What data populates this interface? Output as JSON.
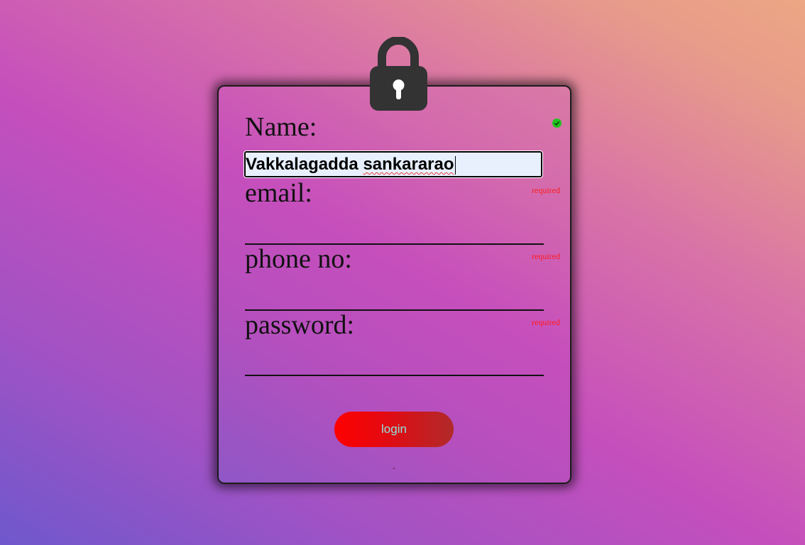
{
  "form": {
    "name_label": "Name:",
    "name_value_part1": "Vakkalagadda ",
    "name_value_part2": "sankararao",
    "email_label": "email:",
    "email_value": "",
    "phone_label": "phone no:",
    "phone_value": "",
    "password_label": "password:",
    "password_value": "",
    "email_hint": "required",
    "phone_hint": "required",
    "password_hint": "required",
    "login_label": "login"
  },
  "icons": {
    "lock": "lock-icon",
    "name_valid": "check-circle-icon"
  },
  "colors": {
    "valid": "#1ec41e",
    "required": "#ff1a1a",
    "button_start": "#ff0000",
    "button_end": "#b02a2a",
    "button_text": "#8fe3dd",
    "lock": "#333333"
  }
}
